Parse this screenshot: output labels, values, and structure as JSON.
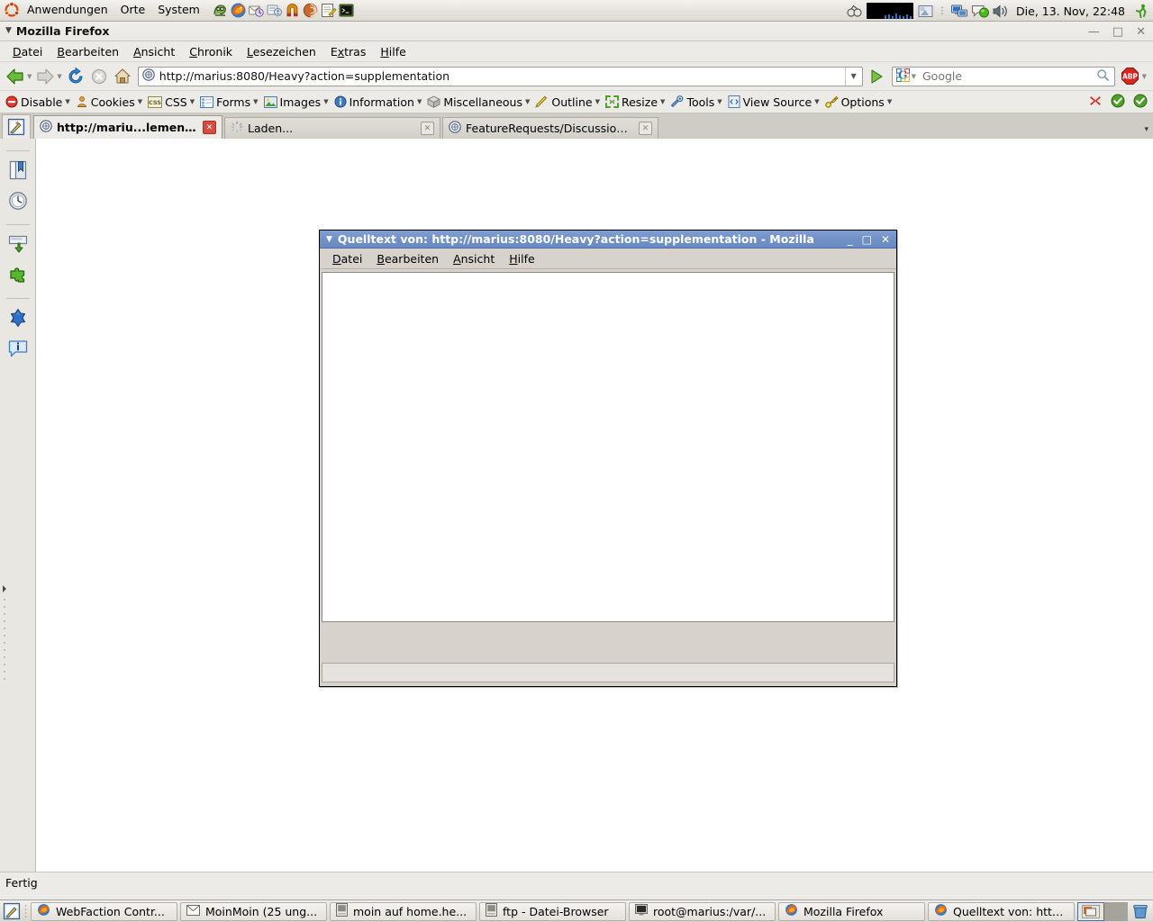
{
  "gnome_panel": {
    "menus": [
      "Anwendungen",
      "Orte",
      "System"
    ],
    "launchers": [
      {
        "name": "gimp-launcher-icon"
      },
      {
        "name": "firefox-launcher-icon"
      },
      {
        "name": "evolution-mail-launcher-icon"
      },
      {
        "name": "evolution-contacts-launcher-icon"
      },
      {
        "name": "magnet-launcher-icon"
      },
      {
        "name": "nautilus-shell-launcher-icon"
      },
      {
        "name": "text-editor-launcher-icon"
      },
      {
        "name": "terminal-launcher-icon"
      }
    ],
    "tray": [
      {
        "name": "system-monitor-icon"
      },
      {
        "name": "cpu-graph-applet"
      },
      {
        "name": "workspace-switcher-icon"
      },
      {
        "name": "network-monitor-icon"
      },
      {
        "name": "chat-presence-icon"
      },
      {
        "name": "volume-icon"
      }
    ],
    "clock": "Die, 13. Nov, 22:48",
    "logout_icon": "logout-icon"
  },
  "firefox": {
    "window_title": "Mozilla Firefox",
    "window_buttons": {
      "minimize": "—",
      "maximize": "□",
      "close": "✕"
    },
    "menubar": [
      {
        "label": "Datei",
        "accel": "D"
      },
      {
        "label": "Bearbeiten",
        "accel": "B"
      },
      {
        "label": "Ansicht",
        "accel": "A"
      },
      {
        "label": "Chronik",
        "accel": "C"
      },
      {
        "label": "Lesezeichen",
        "accel": "L"
      },
      {
        "label": "Extras",
        "accel": "x"
      },
      {
        "label": "Hilfe",
        "accel": "H"
      }
    ],
    "navbar": {
      "back_label": "Zurück",
      "forward_label": "Vor",
      "reload_label": "Neu laden",
      "stop_label": "Stopp",
      "home_label": "Startseite",
      "url": "http://marius:8080/Heavy?action=supplementation",
      "go_label": "Los",
      "search_engine": "Google",
      "search_placeholder": "Google",
      "adblock_label": "ABP"
    },
    "devbar": {
      "items": [
        {
          "label": "Disable",
          "icon": "disable-icon"
        },
        {
          "label": "Cookies",
          "icon": "cookies-icon"
        },
        {
          "label": "CSS",
          "icon": "css-icon"
        },
        {
          "label": "Forms",
          "icon": "forms-icon"
        },
        {
          "label": "Images",
          "icon": "images-icon"
        },
        {
          "label": "Information",
          "icon": "information-icon"
        },
        {
          "label": "Miscellaneous",
          "icon": "miscellaneous-icon"
        },
        {
          "label": "Outline",
          "icon": "outline-icon"
        },
        {
          "label": "Resize",
          "icon": "resize-icon"
        },
        {
          "label": "Tools",
          "icon": "tools-icon"
        },
        {
          "label": "View Source",
          "icon": "view-source-icon"
        },
        {
          "label": "Options",
          "icon": "options-icon"
        }
      ],
      "status_icons": [
        {
          "name": "error-count-icon",
          "value": "✖"
        },
        {
          "name": "css-valid-icon",
          "value": "✔"
        },
        {
          "name": "html-valid-icon",
          "value": "✔"
        }
      ]
    },
    "tabs": [
      {
        "label": "http://mariu...lementation",
        "active": true,
        "loading": false
      },
      {
        "label": "Laden...",
        "active": false,
        "loading": true
      },
      {
        "label": "FeatureRequests/Discussion...",
        "active": false,
        "loading": false
      }
    ],
    "tab_list_caret": "▾",
    "sidebar_icons": [
      {
        "name": "bookmarks-icon"
      },
      {
        "name": "history-clock-icon"
      },
      {
        "name": "downloads-icon"
      },
      {
        "name": "addons-puzzle-icon"
      },
      {
        "name": "blue-gem-icon"
      },
      {
        "name": "page-info-icon"
      }
    ],
    "statusbar": {
      "text": "Fertig"
    }
  },
  "view_source_window": {
    "title": "Quelltext von: http://marius:8080/Heavy?action=supplementation - Mozilla",
    "buttons": {
      "minimize": "_",
      "maximize": "□",
      "close": "✕"
    },
    "menubar": [
      {
        "label": "Datei",
        "accel": "D"
      },
      {
        "label": "Bearbeiten",
        "accel": "B"
      },
      {
        "label": "Ansicht",
        "accel": "A"
      },
      {
        "label": "Hilfe",
        "accel": "H"
      }
    ],
    "source_text": ""
  },
  "taskbar": {
    "show_desktop_label": "Arbeitsfläche anzeigen",
    "items": [
      {
        "label": "WebFaction Contr...",
        "icon": "firefox-icon"
      },
      {
        "label": "MoinMoin (25 ung...",
        "icon": "mail-icon"
      },
      {
        "label": "moin auf home.he...",
        "icon": "terminal-icon"
      },
      {
        "label": "ftp - Datei-Browser",
        "icon": "terminal-icon"
      },
      {
        "label": "root@marius:/var/...",
        "icon": "terminal-dark-icon"
      },
      {
        "label": "Mozilla Firefox",
        "icon": "firefox-icon"
      },
      {
        "label": "Quelltext von: http...",
        "icon": "firefox-icon"
      }
    ],
    "workspaces": [
      {
        "name": "workspace-1",
        "active": true
      },
      {
        "name": "workspace-2",
        "active": false
      }
    ],
    "trash_icon": "trash-icon"
  },
  "colors": {
    "panel_bg": "#e7e4df",
    "firefox_chrome": "#edebe7",
    "vs_titlebar_blue": "#7191c6",
    "tab_strip": "#cfccc6",
    "active_tab_close": "#d94b3d",
    "page_bg": "#ffffff"
  }
}
